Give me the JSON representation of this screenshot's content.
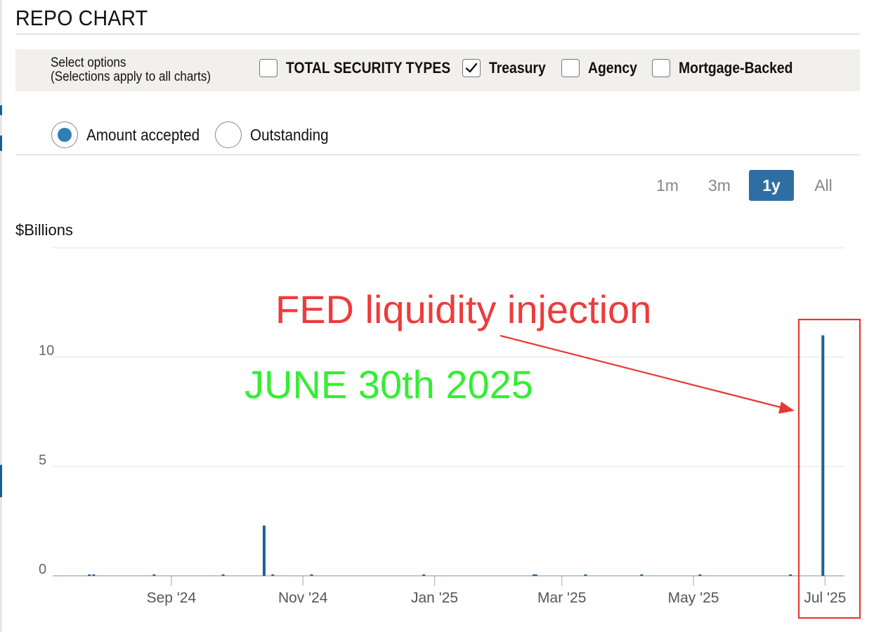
{
  "page": {
    "title": "REPO CHART"
  },
  "options": {
    "caption_line1": "Select options",
    "caption_line2": "(Selections apply to all charts)",
    "checkboxes": [
      {
        "label": "TOTAL SECURITY TYPES",
        "checked": false
      },
      {
        "label": "Treasury",
        "checked": true
      },
      {
        "label": "Agency",
        "checked": false
      },
      {
        "label": "Mortgage-Backed",
        "checked": false
      }
    ],
    "radios": [
      {
        "label": "Amount accepted",
        "selected": true
      },
      {
        "label": "Outstanding",
        "selected": false
      }
    ]
  },
  "range_buttons": [
    {
      "label": "1m",
      "active": false
    },
    {
      "label": "3m",
      "active": false
    },
    {
      "label": "1y",
      "active": true
    },
    {
      "label": "All",
      "active": false
    }
  ],
  "chart_data": {
    "type": "bar",
    "ylabel": "$Billions",
    "ylim": [
      0,
      15
    ],
    "yticks": [
      0,
      5,
      10
    ],
    "xlim": [
      "2024-07-08",
      "2025-07-10"
    ],
    "xticks": [
      {
        "date": "2024-09-01",
        "label": "Sep '24"
      },
      {
        "date": "2024-11-01",
        "label": "Nov '24"
      },
      {
        "date": "2025-01-01",
        "label": "Jan '25"
      },
      {
        "date": "2025-03-01",
        "label": "Mar '25"
      },
      {
        "date": "2025-05-01",
        "label": "May '25"
      },
      {
        "date": "2025-07-01",
        "label": "Jul '25"
      }
    ],
    "grid": true,
    "series": [
      {
        "color": "#1f5f93",
        "points": [
          {
            "date": "2024-07-25",
            "value": 0.05
          },
          {
            "date": "2024-07-27",
            "value": 0.05
          },
          {
            "date": "2024-08-24",
            "value": 0.05
          },
          {
            "date": "2024-09-25",
            "value": 0.05
          },
          {
            "date": "2024-10-14",
            "value": 2.3
          },
          {
            "date": "2024-10-18",
            "value": 0.05
          },
          {
            "date": "2024-11-05",
            "value": 0.05
          },
          {
            "date": "2024-12-27",
            "value": 0.05
          },
          {
            "date": "2025-02-16",
            "value": 0.05
          },
          {
            "date": "2025-02-17",
            "value": 0.05
          },
          {
            "date": "2025-03-12",
            "value": 0.05
          },
          {
            "date": "2025-04-07",
            "value": 0.05
          },
          {
            "date": "2025-05-04",
            "value": 0.05
          },
          {
            "date": "2025-06-15",
            "value": 0.05
          },
          {
            "date": "2025-06-30",
            "value": 11.0
          }
        ]
      }
    ],
    "annotations": [
      {
        "text": "FED liquidity injection",
        "color": "#ee3b3b"
      },
      {
        "text": "JUNE 30th 2025",
        "color": "#33ee33"
      }
    ],
    "highlight_box_color": "#e53935"
  }
}
